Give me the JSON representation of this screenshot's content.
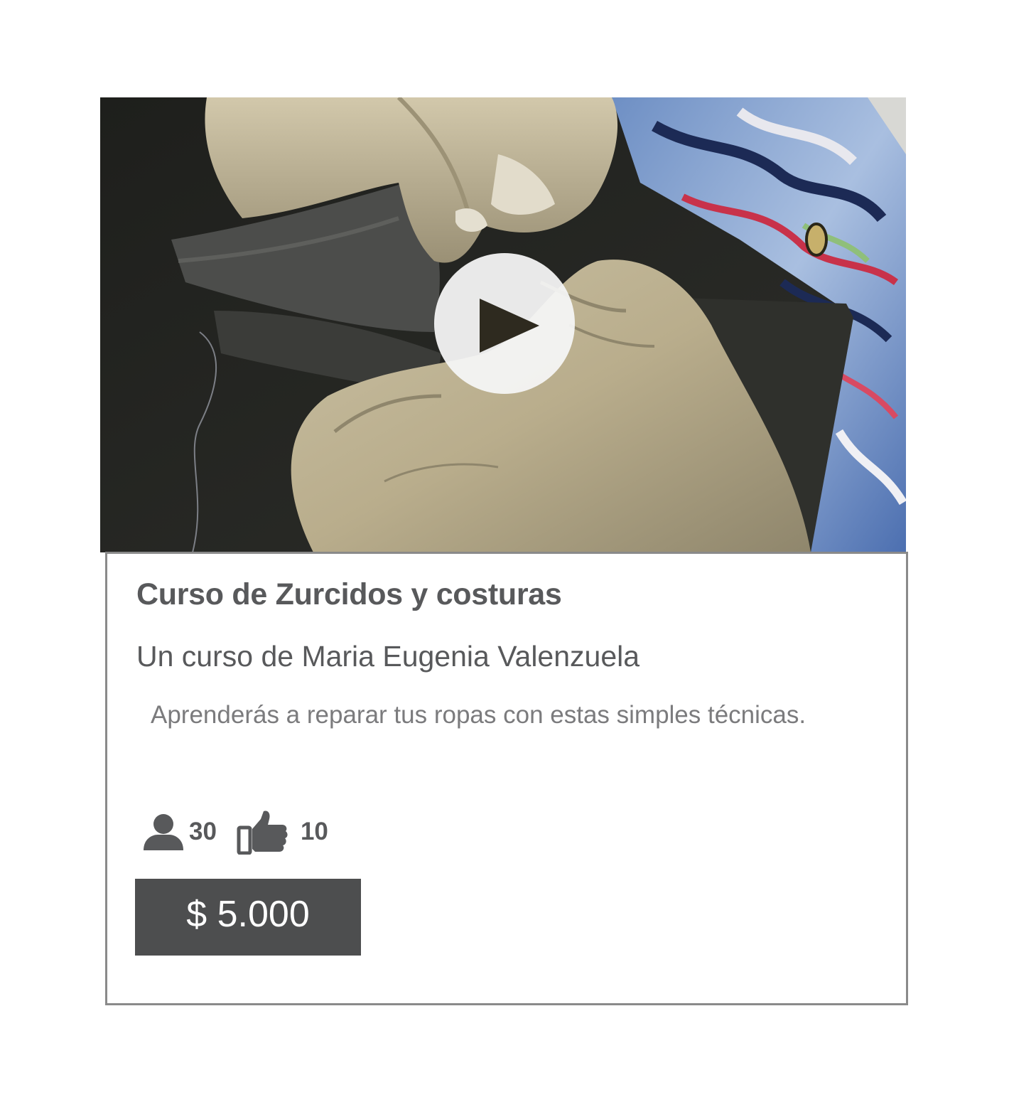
{
  "course": {
    "title": "Curso de Zurcidos y costuras",
    "author": "Un curso de Maria Eugenia Valenzuela",
    "description": "Aprenderás a reparar tus ropas con estas simples técnicas."
  },
  "video": {
    "thumbnail_subject": "hands-sewing-fabric",
    "play_icon": "play-icon"
  },
  "stats": {
    "students_icon": "user-icon",
    "students": "30",
    "likes_icon": "thumbs-up-icon",
    "likes": "10"
  },
  "price": {
    "label": "$ 5.000"
  },
  "colors": {
    "text_dark": "#58595b",
    "text_light": "#7b7b7d",
    "border": "#8a8a8a",
    "button_bg": "#4d4e4f",
    "button_text": "#ffffff"
  }
}
